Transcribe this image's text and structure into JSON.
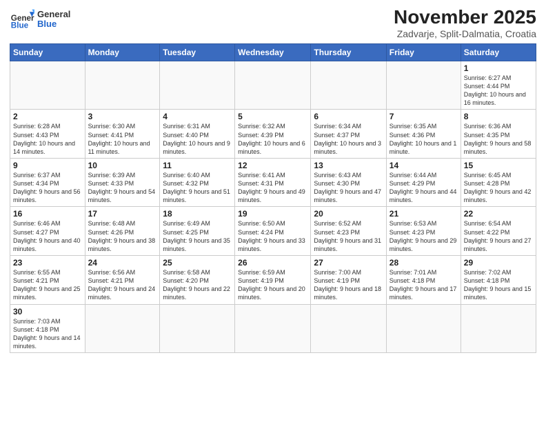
{
  "header": {
    "logo_general": "General",
    "logo_blue": "Blue",
    "month_year": "November 2025",
    "location": "Zadvarje, Split-Dalmatia, Croatia"
  },
  "weekdays": [
    "Sunday",
    "Monday",
    "Tuesday",
    "Wednesday",
    "Thursday",
    "Friday",
    "Saturday"
  ],
  "weeks": [
    [
      {
        "day": "",
        "info": ""
      },
      {
        "day": "",
        "info": ""
      },
      {
        "day": "",
        "info": ""
      },
      {
        "day": "",
        "info": ""
      },
      {
        "day": "",
        "info": ""
      },
      {
        "day": "",
        "info": ""
      },
      {
        "day": "1",
        "info": "Sunrise: 6:27 AM\nSunset: 4:44 PM\nDaylight: 10 hours\nand 16 minutes."
      }
    ],
    [
      {
        "day": "2",
        "info": "Sunrise: 6:28 AM\nSunset: 4:43 PM\nDaylight: 10 hours\nand 14 minutes."
      },
      {
        "day": "3",
        "info": "Sunrise: 6:30 AM\nSunset: 4:41 PM\nDaylight: 10 hours\nand 11 minutes."
      },
      {
        "day": "4",
        "info": "Sunrise: 6:31 AM\nSunset: 4:40 PM\nDaylight: 10 hours\nand 9 minutes."
      },
      {
        "day": "5",
        "info": "Sunrise: 6:32 AM\nSunset: 4:39 PM\nDaylight: 10 hours\nand 6 minutes."
      },
      {
        "day": "6",
        "info": "Sunrise: 6:34 AM\nSunset: 4:37 PM\nDaylight: 10 hours\nand 3 minutes."
      },
      {
        "day": "7",
        "info": "Sunrise: 6:35 AM\nSunset: 4:36 PM\nDaylight: 10 hours\nand 1 minute."
      },
      {
        "day": "8",
        "info": "Sunrise: 6:36 AM\nSunset: 4:35 PM\nDaylight: 9 hours\nand 58 minutes."
      }
    ],
    [
      {
        "day": "9",
        "info": "Sunrise: 6:37 AM\nSunset: 4:34 PM\nDaylight: 9 hours\nand 56 minutes."
      },
      {
        "day": "10",
        "info": "Sunrise: 6:39 AM\nSunset: 4:33 PM\nDaylight: 9 hours\nand 54 minutes."
      },
      {
        "day": "11",
        "info": "Sunrise: 6:40 AM\nSunset: 4:32 PM\nDaylight: 9 hours\nand 51 minutes."
      },
      {
        "day": "12",
        "info": "Sunrise: 6:41 AM\nSunset: 4:31 PM\nDaylight: 9 hours\nand 49 minutes."
      },
      {
        "day": "13",
        "info": "Sunrise: 6:43 AM\nSunset: 4:30 PM\nDaylight: 9 hours\nand 47 minutes."
      },
      {
        "day": "14",
        "info": "Sunrise: 6:44 AM\nSunset: 4:29 PM\nDaylight: 9 hours\nand 44 minutes."
      },
      {
        "day": "15",
        "info": "Sunrise: 6:45 AM\nSunset: 4:28 PM\nDaylight: 9 hours\nand 42 minutes."
      }
    ],
    [
      {
        "day": "16",
        "info": "Sunrise: 6:46 AM\nSunset: 4:27 PM\nDaylight: 9 hours\nand 40 minutes."
      },
      {
        "day": "17",
        "info": "Sunrise: 6:48 AM\nSunset: 4:26 PM\nDaylight: 9 hours\nand 38 minutes."
      },
      {
        "day": "18",
        "info": "Sunrise: 6:49 AM\nSunset: 4:25 PM\nDaylight: 9 hours\nand 35 minutes."
      },
      {
        "day": "19",
        "info": "Sunrise: 6:50 AM\nSunset: 4:24 PM\nDaylight: 9 hours\nand 33 minutes."
      },
      {
        "day": "20",
        "info": "Sunrise: 6:52 AM\nSunset: 4:23 PM\nDaylight: 9 hours\nand 31 minutes."
      },
      {
        "day": "21",
        "info": "Sunrise: 6:53 AM\nSunset: 4:23 PM\nDaylight: 9 hours\nand 29 minutes."
      },
      {
        "day": "22",
        "info": "Sunrise: 6:54 AM\nSunset: 4:22 PM\nDaylight: 9 hours\nand 27 minutes."
      }
    ],
    [
      {
        "day": "23",
        "info": "Sunrise: 6:55 AM\nSunset: 4:21 PM\nDaylight: 9 hours\nand 25 minutes."
      },
      {
        "day": "24",
        "info": "Sunrise: 6:56 AM\nSunset: 4:21 PM\nDaylight: 9 hours\nand 24 minutes."
      },
      {
        "day": "25",
        "info": "Sunrise: 6:58 AM\nSunset: 4:20 PM\nDaylight: 9 hours\nand 22 minutes."
      },
      {
        "day": "26",
        "info": "Sunrise: 6:59 AM\nSunset: 4:19 PM\nDaylight: 9 hours\nand 20 minutes."
      },
      {
        "day": "27",
        "info": "Sunrise: 7:00 AM\nSunset: 4:19 PM\nDaylight: 9 hours\nand 18 minutes."
      },
      {
        "day": "28",
        "info": "Sunrise: 7:01 AM\nSunset: 4:18 PM\nDaylight: 9 hours\nand 17 minutes."
      },
      {
        "day": "29",
        "info": "Sunrise: 7:02 AM\nSunset: 4:18 PM\nDaylight: 9 hours\nand 15 minutes."
      }
    ],
    [
      {
        "day": "30",
        "info": "Sunrise: 7:03 AM\nSunset: 4:18 PM\nDaylight: 9 hours\nand 14 minutes."
      },
      {
        "day": "",
        "info": ""
      },
      {
        "day": "",
        "info": ""
      },
      {
        "day": "",
        "info": ""
      },
      {
        "day": "",
        "info": ""
      },
      {
        "day": "",
        "info": ""
      },
      {
        "day": "",
        "info": ""
      }
    ]
  ]
}
